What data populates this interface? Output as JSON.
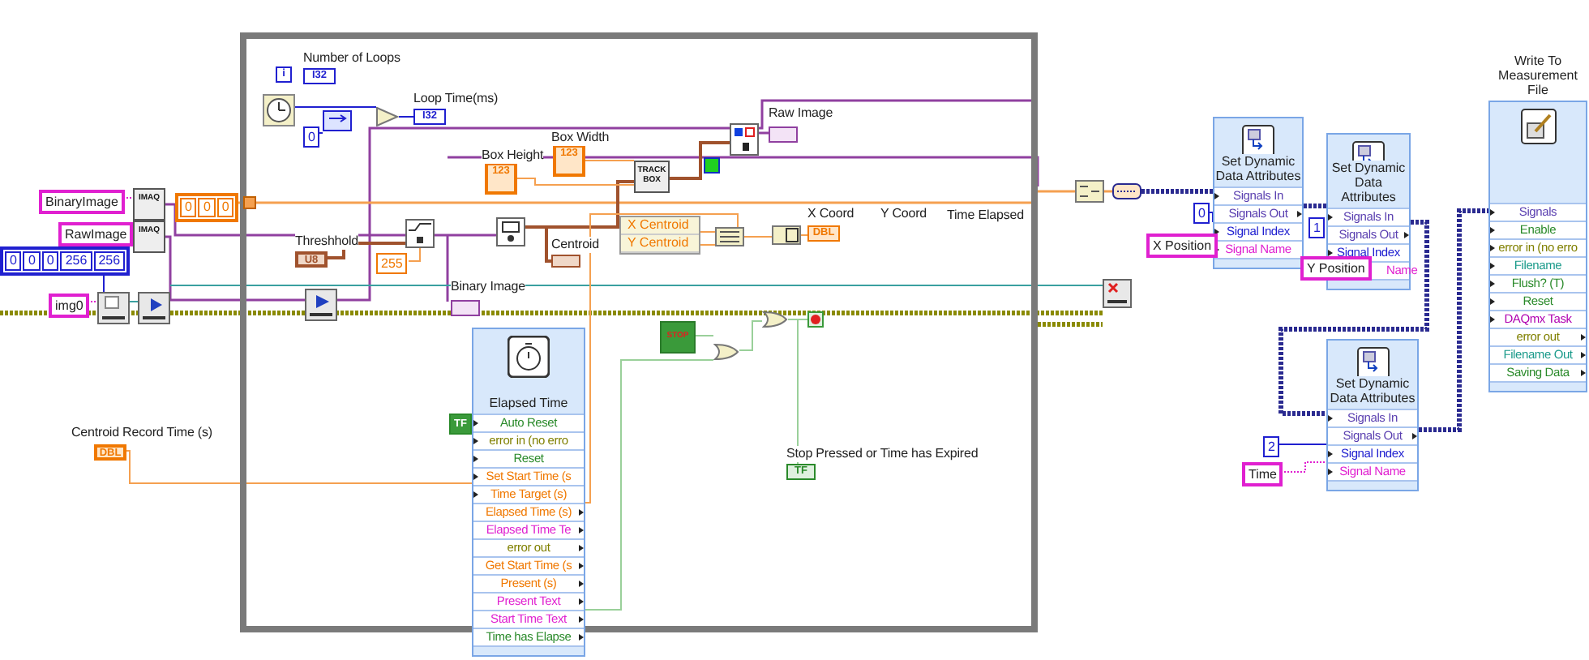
{
  "labels": [
    "Number of Loops",
    "Loop Time(ms)",
    "Box Height",
    "Box Width",
    "Raw Image",
    "Threshhold",
    "Centroid",
    "X Coord",
    "Y Coord",
    "Time Elapsed",
    "Binary Image",
    "Stop Pressed or Time has Expired",
    "Centroid Record Time (s)"
  ],
  "terminals": [
    {
      "control": false,
      "kind": "iteration",
      "text": "i"
    },
    {
      "control": false,
      "kind": "i32",
      "text": "I32"
    },
    {
      "control": false,
      "kind": "i32",
      "text": "I32"
    },
    {
      "control": true,
      "kind": "numeric",
      "text": "123"
    },
    {
      "control": true,
      "kind": "numeric",
      "text": "123"
    },
    {
      "control": false,
      "kind": "image"
    },
    {
      "control": true,
      "kind": "u8",
      "text": "U8"
    },
    {
      "control": false,
      "kind": "u8"
    },
    {
      "control": false,
      "kind": "numeric",
      "text": "DBL"
    },
    {
      "control": false,
      "kind": "image"
    },
    {
      "control": false,
      "kind": "bool",
      "text": "TF"
    },
    {
      "control": true,
      "kind": "numeric",
      "text": "DBL"
    }
  ],
  "constants": [
    {
      "kind": "i32",
      "items": [
        "0"
      ]
    },
    {
      "kind": "numeric",
      "items": [
        "255"
      ]
    },
    {
      "kind": "string",
      "items": [
        "BinaryImage"
      ]
    },
    {
      "kind": "string",
      "items": [
        "RawImage"
      ]
    },
    {
      "kind": "i32",
      "items": [
        "0",
        "0",
        "0",
        "256",
        "256"
      ]
    },
    {
      "kind": "string",
      "items": [
        "img0"
      ]
    },
    {
      "kind": "numeric",
      "items": [
        "0",
        "0",
        "0"
      ]
    },
    {
      "kind": "bool",
      "items": [
        "TF"
      ]
    },
    {
      "kind": "i32",
      "items": [
        "0"
      ]
    },
    {
      "kind": "string",
      "items": [
        "X Position"
      ]
    },
    {
      "kind": "i32",
      "items": [
        "1"
      ]
    },
    {
      "kind": "string",
      "items": [
        "Y Position"
      ]
    },
    {
      "kind": "i32",
      "items": [
        "2"
      ]
    },
    {
      "kind": "string",
      "items": [
        "Time"
      ]
    }
  ],
  "nodes": [
    {
      "kind": "imaq",
      "text": "IMAQ"
    },
    {
      "kind": "imaq",
      "text": "IMAQ"
    },
    {
      "kind": "track",
      "text": "TRACK BOX"
    },
    {
      "kind": "stop",
      "text": "STOP"
    }
  ],
  "unbundle": {
    "rows": [
      "X Centroid",
      "Y Centroid"
    ]
  },
  "express_vis": [
    {
      "kind": "timer",
      "title": "Elapsed Time",
      "rows": [
        {
          "text": "Auto Reset",
          "kind": "bool",
          "output": false
        },
        {
          "text": "error in (no erro",
          "kind": "error",
          "output": false
        },
        {
          "text": "Reset",
          "kind": "bool",
          "output": false
        },
        {
          "text": "Set Start Time (s",
          "kind": "numeric",
          "output": false
        },
        {
          "text": "Time Target (s)",
          "kind": "numeric",
          "output": false
        },
        {
          "text": "Elapsed Time (s)",
          "kind": "numeric",
          "output": true
        },
        {
          "text": "Elapsed Time Te",
          "kind": "string",
          "output": true
        },
        {
          "text": "error out",
          "kind": "error",
          "output": true
        },
        {
          "text": "Get Start Time (s",
          "kind": "numeric",
          "output": true
        },
        {
          "text": "Present (s)",
          "kind": "numeric",
          "output": true
        },
        {
          "text": "Present Text",
          "kind": "string",
          "output": true
        },
        {
          "text": "Start Time Text",
          "kind": "string",
          "output": true
        },
        {
          "text": "Time has Elapse",
          "kind": "bool",
          "output": true
        }
      ]
    },
    {
      "kind": "attributes",
      "title": "Set Dynamic Data Attributes",
      "rows": [
        {
          "text": "Signals In",
          "kind": "dynamic",
          "output": false
        },
        {
          "text": "Signals Out",
          "kind": "dynamic",
          "output": true
        },
        {
          "text": "Signal Index",
          "kind": "i32",
          "output": false
        },
        {
          "text": "Signal Name",
          "kind": "string",
          "output": false
        }
      ]
    },
    {
      "kind": "attributes",
      "title": "Set Dynamic Data Attributes",
      "rows": [
        {
          "text": "Signals In",
          "kind": "dynamic",
          "output": false
        },
        {
          "text": "Signals Out",
          "kind": "dynamic",
          "output": true
        },
        {
          "text": "Signal Index",
          "kind": "i32",
          "output": false
        },
        {
          "text": "Name",
          "kind": "string",
          "output": false,
          "partly_covered": true
        }
      ]
    },
    {
      "kind": "attributes",
      "title": "Set Dynamic Data Attributes",
      "rows": [
        {
          "text": "Signals In",
          "kind": "dynamic",
          "output": false
        },
        {
          "text": "Signals Out",
          "kind": "dynamic",
          "output": true
        },
        {
          "text": "Signal Index",
          "kind": "i32",
          "output": false
        },
        {
          "text": "Signal Name",
          "kind": "string",
          "output": false
        }
      ]
    },
    {
      "kind": "file",
      "title": "Write To Measurement File",
      "rows": [
        {
          "text": "Signals",
          "kind": "dynamic",
          "output": false
        },
        {
          "text": "Enable",
          "kind": "bool",
          "output": false
        },
        {
          "text": "error in (no erro",
          "kind": "error",
          "output": false
        },
        {
          "text": "Filename",
          "kind": "path",
          "output": false
        },
        {
          "text": "Flush? (T)",
          "kind": "bool",
          "output": false
        },
        {
          "text": "Reset",
          "kind": "bool",
          "output": false
        },
        {
          "text": "DAQmx Task",
          "kind": "task",
          "output": false
        },
        {
          "text": "error out",
          "kind": "error",
          "output": true
        },
        {
          "text": "Filename Out",
          "kind": "path",
          "output": true
        },
        {
          "text": "Saving Data",
          "kind": "bool",
          "output": true
        }
      ]
    }
  ]
}
